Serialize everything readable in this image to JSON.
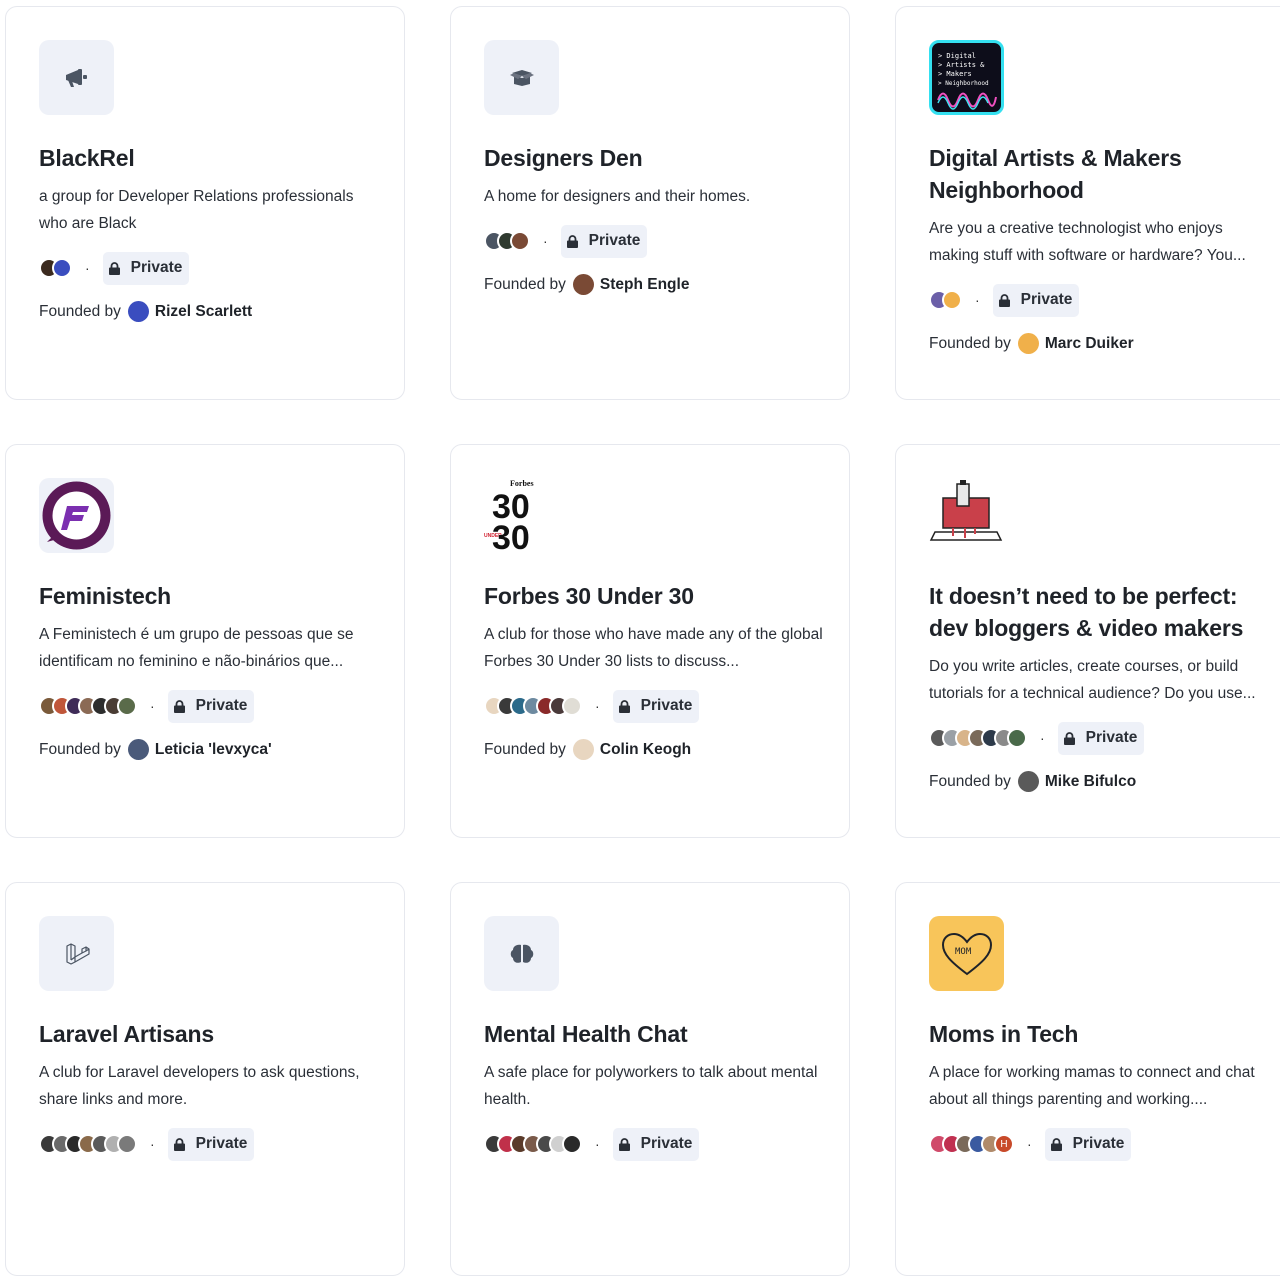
{
  "common": {
    "private_label": "Private",
    "founded_by_label": "Founded by",
    "separator": "·"
  },
  "cards": [
    {
      "title": "BlackRel",
      "description": "a group for Developer Relations professionals who are Black",
      "logo_icon": "megaphone-icon",
      "founder": "Rizel Scarlett",
      "member_colors": [
        "#3b2a1e",
        "#3a4dbf"
      ]
    },
    {
      "title": "Designers Den",
      "description": "A home for designers and their homes.",
      "logo_icon": "box-icon",
      "founder": "Steph Engle",
      "member_colors": [
        "#4b5563",
        "#2f3a2f",
        "#7a4a35"
      ]
    },
    {
      "title": "Digital Artists & Makers Neighborhood",
      "description": "Are you a creative technologist who enjoys making stuff with software or hardware? You...",
      "logo_text": [
        "> Digital",
        "> Artists &",
        "> Makers",
        "> Neighborhood"
      ],
      "founder": "Marc Duiker",
      "member_colors": [
        "#6b5fa8",
        "#f0b04a"
      ]
    },
    {
      "title": "Feministech",
      "description": "A Feministech é um grupo de pessoas que se identificam no feminino e não-binários que...",
      "logo_icon": "feministech-logo-icon",
      "founder": "Leticia 'levxyca'",
      "member_colors": [
        "#7a5a3a",
        "#c0563a",
        "#3f2c58",
        "#8b6a55",
        "#2d2d2d",
        "#4a3d35",
        "#5a6b4a"
      ]
    },
    {
      "title": "Forbes 30 Under 30",
      "description": "A club for those who have made any of the global Forbes 30 Under 30 lists to discuss...",
      "logo_text": [
        "Forbes",
        "30",
        "UNDER",
        "30"
      ],
      "founder": "Colin Keogh",
      "member_colors": [
        "#e8d6c0",
        "#3a3a3a",
        "#2b6a8a",
        "#6d8aa0",
        "#8a2a2a",
        "#4a3a3a",
        "#e0ddd5"
      ]
    },
    {
      "title": "It doesn’t need to be perfect: dev bloggers & video makers",
      "description": "Do you write articles, create courses, or build tutorials for a technical audience? Do you use...",
      "logo_icon": "laptop-paint-icon",
      "founder": "Mike Bifulco",
      "member_colors": [
        "#5a5a5a",
        "#9aa0a6",
        "#d8b48a",
        "#7a6a5a",
        "#2d3a4a",
        "#8a8a8a",
        "#4a6a4a"
      ]
    },
    {
      "title": "Laravel Artisans",
      "description": "A club for Laravel developers to ask questions, share links and more.",
      "logo_icon": "laravel-icon",
      "founder": "",
      "member_colors": [
        "#3a3a3a",
        "#6a6a6a",
        "#2a2a2a",
        "#8a6a4a",
        "#5a5a5a",
        "#b0b0b0",
        "#7a7a7a"
      ]
    },
    {
      "title": "Mental Health Chat",
      "description": "A safe place for polyworkers to talk about mental health.",
      "logo_icon": "brain-icon",
      "founder": "",
      "member_colors": [
        "#3a3a3a",
        "#c0304a",
        "#5a3a2a",
        "#7a5a4a",
        "#4a4a4a",
        "#d0d0d0",
        "#2a2a2a"
      ]
    },
    {
      "title": "Moms in Tech",
      "description": "A place for working mamas to connect and chat about all things parenting and working....",
      "logo_icon": "heart-mom-icon",
      "logo_text": [
        "MOM"
      ],
      "founder": "",
      "member_colors": [
        "#d04a6a",
        "#c03050",
        "#7a6a5a",
        "#3a5aa0",
        "#b08a6a",
        "#c84a2a"
      ],
      "member_initial": "H"
    }
  ],
  "colors": {
    "page_bg": "#ffffff",
    "card_border": "#e6e8ee",
    "logo_bg": "#eef1f8",
    "mom_logo_bg": "#f8c55a"
  }
}
